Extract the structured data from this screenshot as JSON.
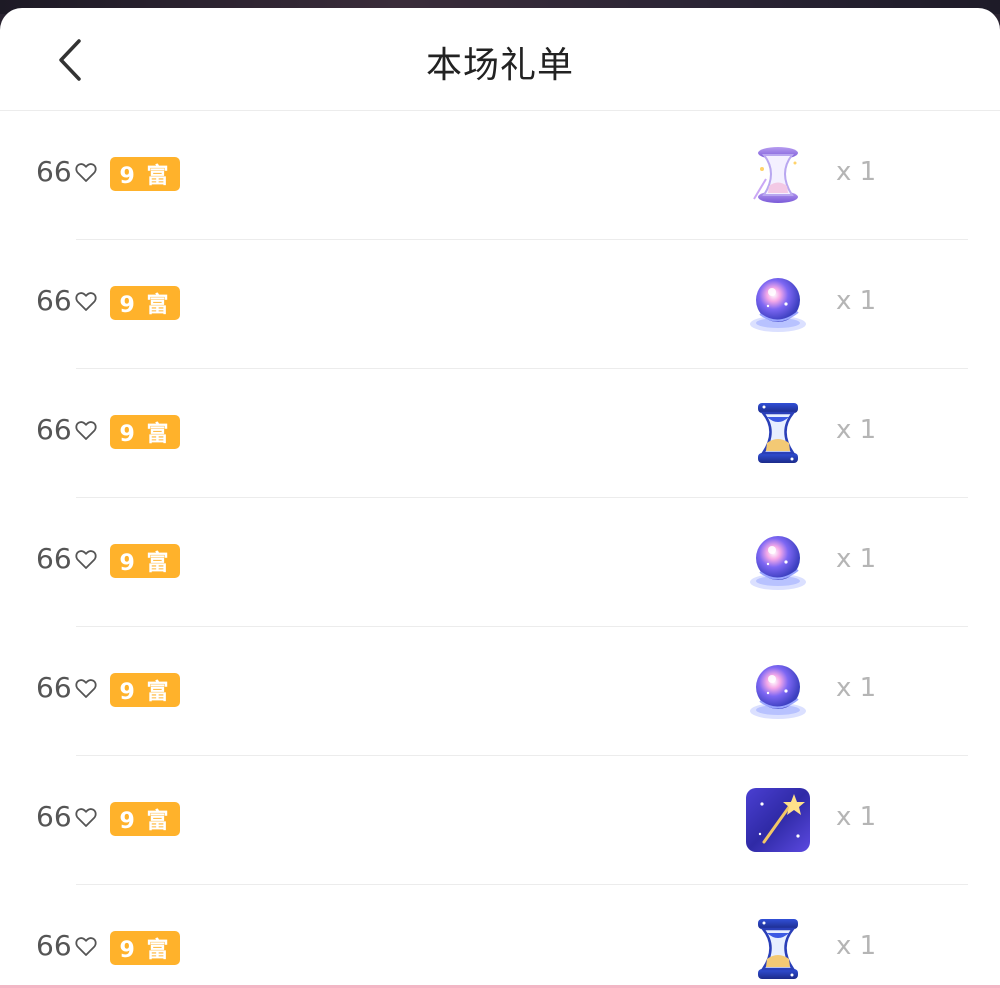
{
  "header": {
    "title": "本场礼单",
    "back_icon": "chevron-left-icon"
  },
  "colors": {
    "badge": "#ffb22b",
    "quantity": "#b5b5b5",
    "amount": "#555555"
  },
  "rows": [
    {
      "amount": "66",
      "badge": "9 富",
      "gift_icon": "purple-hourglass-icon",
      "quantity": "x 1"
    },
    {
      "amount": "66",
      "badge": "9 富",
      "gift_icon": "crystal-ball-icon",
      "quantity": "x 1"
    },
    {
      "amount": "66",
      "badge": "9 富",
      "gift_icon": "blue-hourglass-icon",
      "quantity": "x 1"
    },
    {
      "amount": "66",
      "badge": "9 富",
      "gift_icon": "crystal-ball-icon",
      "quantity": "x 1"
    },
    {
      "amount": "66",
      "badge": "9 富",
      "gift_icon": "crystal-ball-icon",
      "quantity": "x 1"
    },
    {
      "amount": "66",
      "badge": "9 富",
      "gift_icon": "magic-wand-icon",
      "quantity": "x 1"
    },
    {
      "amount": "66",
      "badge": "9 富",
      "gift_icon": "blue-hourglass-icon",
      "quantity": "x 1"
    }
  ]
}
